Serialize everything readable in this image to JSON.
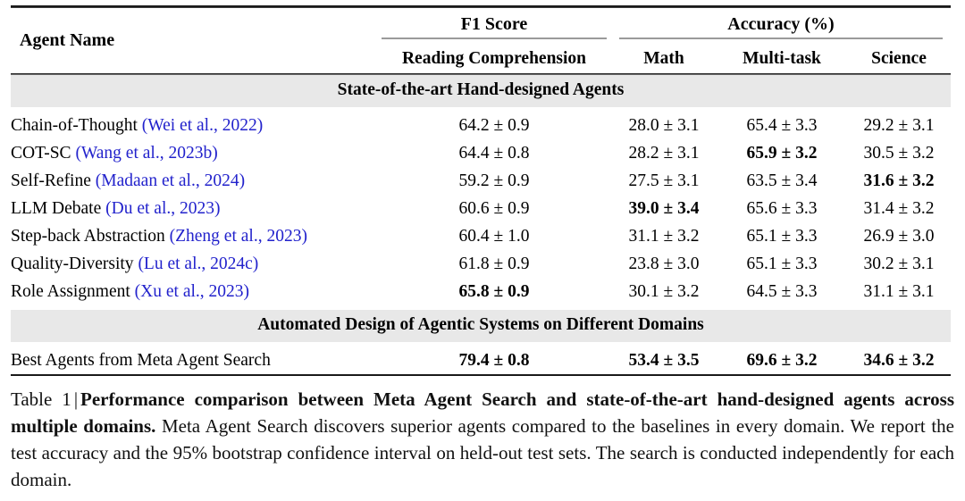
{
  "table": {
    "header": {
      "name_col": "Agent Name",
      "groups": [
        {
          "label": "F1 Score",
          "sub": [
            "Reading Comprehension"
          ]
        },
        {
          "label": "Accuracy (%)",
          "sub": [
            "Math",
            "Multi-task",
            "Science"
          ]
        }
      ],
      "sub_all": [
        "Reading Comprehension",
        "Math",
        "Multi-task",
        "Science"
      ]
    },
    "sections": [
      {
        "title": "State-of-the-art Hand-designed Agents",
        "rows": [
          {
            "name": "Chain-of-Thought",
            "citation": "(Wei et al., 2022)",
            "reading_comprehension": "64.2 ± 0.9",
            "math": "28.0 ± 3.1",
            "multi_task": "65.4 ± 3.3",
            "science": "29.2 ± 3.1",
            "bold": {
              "reading_comprehension": false,
              "math": false,
              "multi_task": false,
              "science": false
            }
          },
          {
            "name": "COT-SC",
            "citation": "(Wang et al., 2023b)",
            "reading_comprehension": "64.4 ± 0.8",
            "math": "28.2 ± 3.1",
            "multi_task": "65.9 ± 3.2",
            "science": "30.5 ± 3.2",
            "bold": {
              "reading_comprehension": false,
              "math": false,
              "multi_task": true,
              "science": false
            }
          },
          {
            "name": "Self-Refine",
            "citation": "(Madaan et al., 2024)",
            "reading_comprehension": "59.2 ± 0.9",
            "math": "27.5 ± 3.1",
            "multi_task": "63.5 ± 3.4",
            "science": "31.6 ± 3.2",
            "bold": {
              "reading_comprehension": false,
              "math": false,
              "multi_task": false,
              "science": true
            }
          },
          {
            "name": "LLM Debate",
            "citation": "(Du et al., 2023)",
            "reading_comprehension": "60.6 ± 0.9",
            "math": "39.0 ± 3.4",
            "multi_task": "65.6 ± 3.3",
            "science": "31.4 ± 3.2",
            "bold": {
              "reading_comprehension": false,
              "math": true,
              "multi_task": false,
              "science": false
            }
          },
          {
            "name": "Step-back Abstraction",
            "citation": "(Zheng et al., 2023)",
            "reading_comprehension": "60.4 ± 1.0",
            "math": "31.1 ± 3.2",
            "multi_task": "65.1 ± 3.3",
            "science": "26.9 ± 3.0",
            "bold": {
              "reading_comprehension": false,
              "math": false,
              "multi_task": false,
              "science": false
            }
          },
          {
            "name": "Quality-Diversity",
            "citation": "(Lu et al., 2024c)",
            "reading_comprehension": "61.8 ± 0.9",
            "math": "23.8 ± 3.0",
            "multi_task": "65.1 ± 3.3",
            "science": "30.2 ± 3.1",
            "bold": {
              "reading_comprehension": false,
              "math": false,
              "multi_task": false,
              "science": false
            }
          },
          {
            "name": "Role Assignment",
            "citation": "(Xu et al., 2023)",
            "reading_comprehension": "65.8 ± 0.9",
            "math": "30.1 ± 3.2",
            "multi_task": "64.5 ± 3.3",
            "science": "31.1 ± 3.1",
            "bold": {
              "reading_comprehension": true,
              "math": false,
              "multi_task": false,
              "science": false
            }
          }
        ]
      },
      {
        "title": "Automated Design of Agentic Systems on Different Domains",
        "rows": [
          {
            "name": "Best Agents from Meta Agent Search",
            "citation": "",
            "reading_comprehension": "79.4 ± 0.8",
            "math": "53.4 ± 3.5",
            "multi_task": "69.6 ± 3.2",
            "science": "34.6 ± 3.2",
            "bold": {
              "reading_comprehension": true,
              "math": true,
              "multi_task": true,
              "science": true
            }
          }
        ]
      }
    ]
  },
  "caption": {
    "label": "Table 1",
    "separator": "|",
    "bold_part": "Performance comparison between Meta Agent Search and state-of-the-art hand-designed agents across multiple domains.",
    "rest": "Meta Agent Search discovers superior agents compared to the baselines in every domain. We report the test accuracy and the 95% bootstrap confidence interval on held-out test sets. The search is conducted independently for each domain."
  },
  "colors": {
    "citation_link": "#2222cc",
    "section_band": "#e8e8e8",
    "rule": "#1a1a1a",
    "group_rule": "#9a9a9a"
  }
}
